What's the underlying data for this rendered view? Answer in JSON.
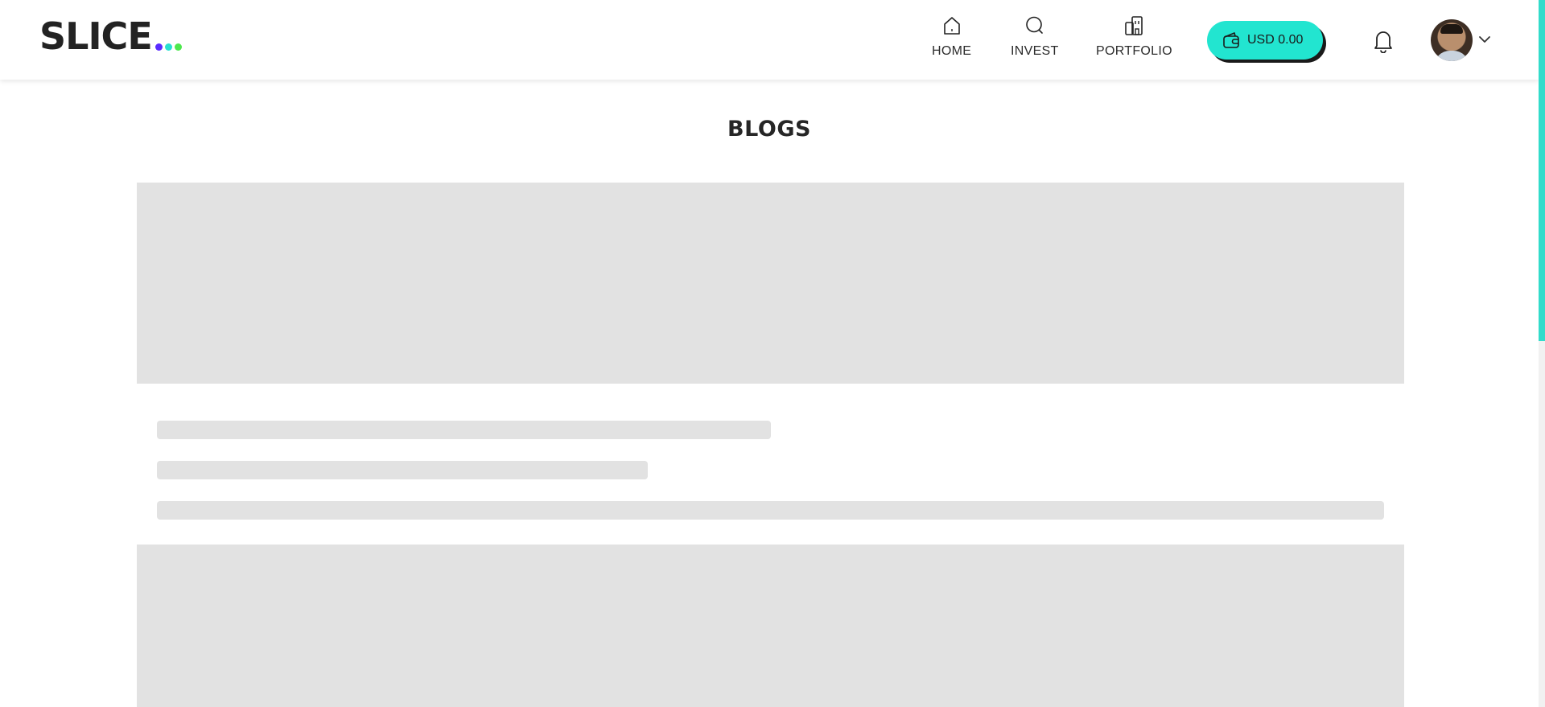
{
  "app": {
    "logo_text": "SLICE",
    "logo_dot_colors": [
      "#5a2cff",
      "#28e0d0",
      "#4de84d"
    ]
  },
  "nav": {
    "items": [
      {
        "label": "HOME",
        "icon": "home-icon"
      },
      {
        "label": "INVEST",
        "icon": "search-icon"
      },
      {
        "label": "PORTFOLIO",
        "icon": "buildings-icon"
      }
    ]
  },
  "wallet": {
    "label": "USD 0.00",
    "icon": "wallet-icon",
    "color": "#22e5d0"
  },
  "header_icons": {
    "notifications": "bell-icon",
    "profile_menu": "chevron-down-icon"
  },
  "main": {
    "title": "BLOGS"
  },
  "colors": {
    "accent": "#22e5d0",
    "skeleton": "#e2e2e2",
    "text": "#262626"
  }
}
